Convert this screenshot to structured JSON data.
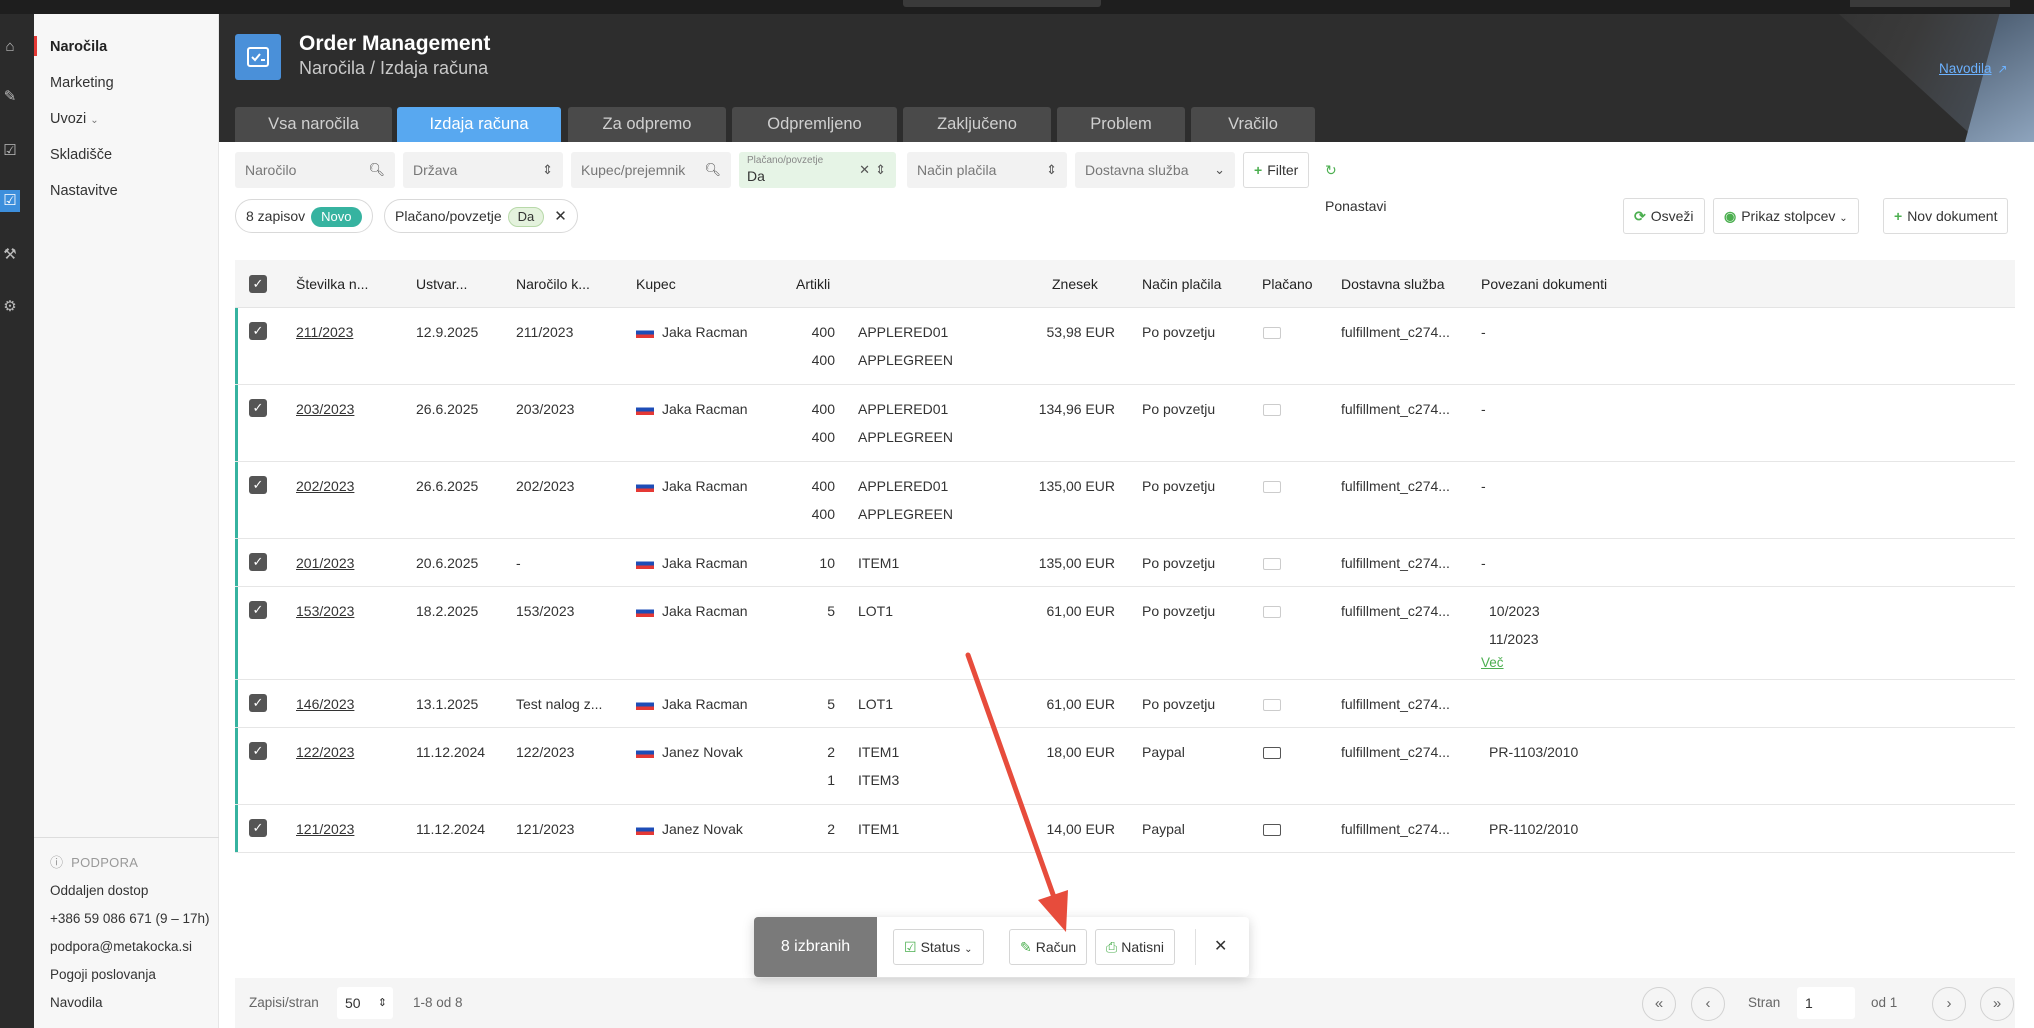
{
  "header": {
    "title": "Order Management",
    "subtitle": "Naročila / Izdaja računa",
    "guide_link": "Navodila"
  },
  "sidebar": {
    "items": [
      {
        "label": "Naročila"
      },
      {
        "label": "Marketing"
      },
      {
        "label": "Uvozi"
      },
      {
        "label": "Skladišče"
      },
      {
        "label": "Nastavitve"
      }
    ],
    "support": {
      "heading": "PODPORA",
      "lines": [
        "Oddaljen dostop",
        "+386 59 086 671 (9 – 17h)",
        "podpora@metakocka.si",
        "Pogoji poslovanja",
        "Navodila"
      ]
    }
  },
  "tabs": [
    {
      "label": "Vsa naročila"
    },
    {
      "label": "Izdaja računa"
    },
    {
      "label": "Za odpremo"
    },
    {
      "label": "Odpremljeno"
    },
    {
      "label": "Zaključeno"
    },
    {
      "label": "Problem"
    },
    {
      "label": "Vračilo"
    }
  ],
  "filters": {
    "order_placeholder": "Naročilo",
    "country_placeholder": "Država",
    "buyer_placeholder": "Kupec/prejemnik",
    "paid_label": "Plačano/povzetje",
    "paid_value": "Da",
    "payment_placeholder": "Način plačila",
    "delivery_placeholder": "Dostavna služba",
    "filter_button": "Filter",
    "reset_button": "Ponastavi"
  },
  "chips": {
    "records": "8 zapisov",
    "records_badge": "Novo",
    "paid": "Plačano/povzetje",
    "paid_badge": "Da"
  },
  "toolbar": {
    "refresh": "Osveži",
    "columns": "Prikaz stolpcev",
    "new_doc": "Nov dokument"
  },
  "table": {
    "headers": [
      "Številka n...",
      "Ustvar...",
      "Naročilo k...",
      "Kupec",
      "Artikli",
      "Znesek",
      "Način plačila",
      "Plačano",
      "Dostavna služba",
      "Povezani dokumenti"
    ],
    "rows": [
      {
        "number": "211/2023",
        "created": "12.9.2025",
        "order_k": "211/2023",
        "buyer": "Jaka Racman",
        "qty1": "400",
        "item1": "APPLERED01",
        "qty2": "400",
        "item2": "APPLEGREEN",
        "amount": "53,98 EUR",
        "payment": "Po povzetju",
        "delivery": "fulfillment_c274...",
        "docs": "-"
      },
      {
        "number": "203/2023",
        "created": "26.6.2025",
        "order_k": "203/2023",
        "buyer": "Jaka Racman",
        "qty1": "400",
        "item1": "APPLERED01",
        "qty2": "400",
        "item2": "APPLEGREEN",
        "amount": "134,96 EUR",
        "payment": "Po povzetju",
        "delivery": "fulfillment_c274...",
        "docs": "-"
      },
      {
        "number": "202/2023",
        "created": "26.6.2025",
        "order_k": "202/2023",
        "buyer": "Jaka Racman",
        "qty1": "400",
        "item1": "APPLERED01",
        "qty2": "400",
        "item2": "APPLEGREEN",
        "amount": "135,00 EUR",
        "payment": "Po povzetju",
        "delivery": "fulfillment_c274...",
        "docs": "-"
      },
      {
        "number": "201/2023",
        "created": "20.6.2025",
        "order_k": "-",
        "buyer": "Jaka Racman",
        "qty1": "10",
        "item1": "ITEM1",
        "amount": "135,00 EUR",
        "payment": "Po povzetju",
        "delivery": "fulfillment_c274...",
        "docs": "-"
      },
      {
        "number": "153/2023",
        "created": "18.2.2025",
        "order_k": "153/2023",
        "buyer": "Jaka Racman",
        "qty1": "5",
        "item1": "LOT1",
        "amount": "61,00 EUR",
        "payment": "Po povzetju",
        "delivery": "fulfillment_c274...",
        "doc1": "10/2023",
        "doc2": "11/2023",
        "more": "Več"
      },
      {
        "number": "146/2023",
        "created": "13.1.2025",
        "order_k": "Test nalog z...",
        "buyer": "Jaka Racman",
        "qty1": "5",
        "item1": "LOT1",
        "amount": "61,00 EUR",
        "payment": "Po povzetju",
        "delivery": "fulfillment_c274..."
      },
      {
        "number": "122/2023",
        "created": "11.12.2024",
        "order_k": "122/2023",
        "buyer": "Janez Novak",
        "qty1": "2",
        "item1": "ITEM1",
        "qty2": "1",
        "item2": "ITEM3",
        "amount": "18,00 EUR",
        "payment": "Paypal",
        "delivery": "fulfillment_c274...",
        "doc1": "PR-1103/2010"
      },
      {
        "number": "121/2023",
        "created": "11.12.2024",
        "order_k": "121/2023",
        "buyer": "Janez Novak",
        "qty1": "2",
        "item1": "ITEM1",
        "amount": "14,00 EUR",
        "payment": "Paypal",
        "delivery": "fulfillment_c274...",
        "doc1": "PR-1102/2010"
      }
    ]
  },
  "action_bar": {
    "selected": "8 izbranih",
    "status": "Status",
    "invoice": "Račun",
    "print": "Natisni"
  },
  "footer": {
    "per_page_label": "Zapisi/stran",
    "per_page": "50",
    "range": "1-8 od 8",
    "page_label": "Stran",
    "page": "1",
    "of": "od 1"
  },
  "colors": {
    "accent": "#58a8f0",
    "teal": "#36b3a0",
    "green": "#4caf50",
    "arrow": "#e74c3c"
  }
}
